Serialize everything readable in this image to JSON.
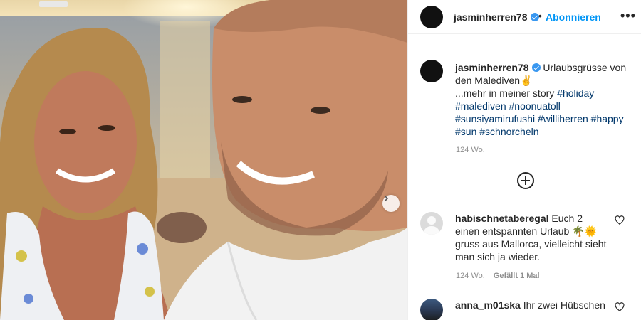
{
  "post": {
    "username": "jasminherren78",
    "follow_label": "Abonnieren",
    "separator": "•",
    "more_label": "•••",
    "caption_text": " Urlaubsgrüsse von den Malediven✌️",
    "caption_line2": "...mehr in meiner story ",
    "hashtags": [
      "#holiday",
      "#malediven",
      "#noonuatoll",
      "#sunsiyamirufushi",
      "#williherren",
      "#happy",
      "#sun",
      "#schnorcheln"
    ],
    "time": "124 Wo."
  },
  "comments": [
    {
      "username": "habischnetaberegal",
      "text": " Euch 2 einen entspannten Urlaub 🌴🌞 gruss aus Mallorca, vielleicht sieht man sich ja wieder.",
      "time": "124 Wo.",
      "likes": "Gefällt 1 Mal"
    },
    {
      "username": "anna_m01ska",
      "text": " Ihr zwei Hübschen"
    }
  ],
  "colors": {
    "accent": "#0095f6",
    "verified": "#3897f0",
    "hashtag": "#00376b",
    "muted": "#8e8e8e"
  },
  "icons": {
    "verified": "verified-badge-icon",
    "more": "more-options-icon",
    "add_comment": "add-circle-icon",
    "like": "heart-icon",
    "next": "chevron-right-icon"
  }
}
